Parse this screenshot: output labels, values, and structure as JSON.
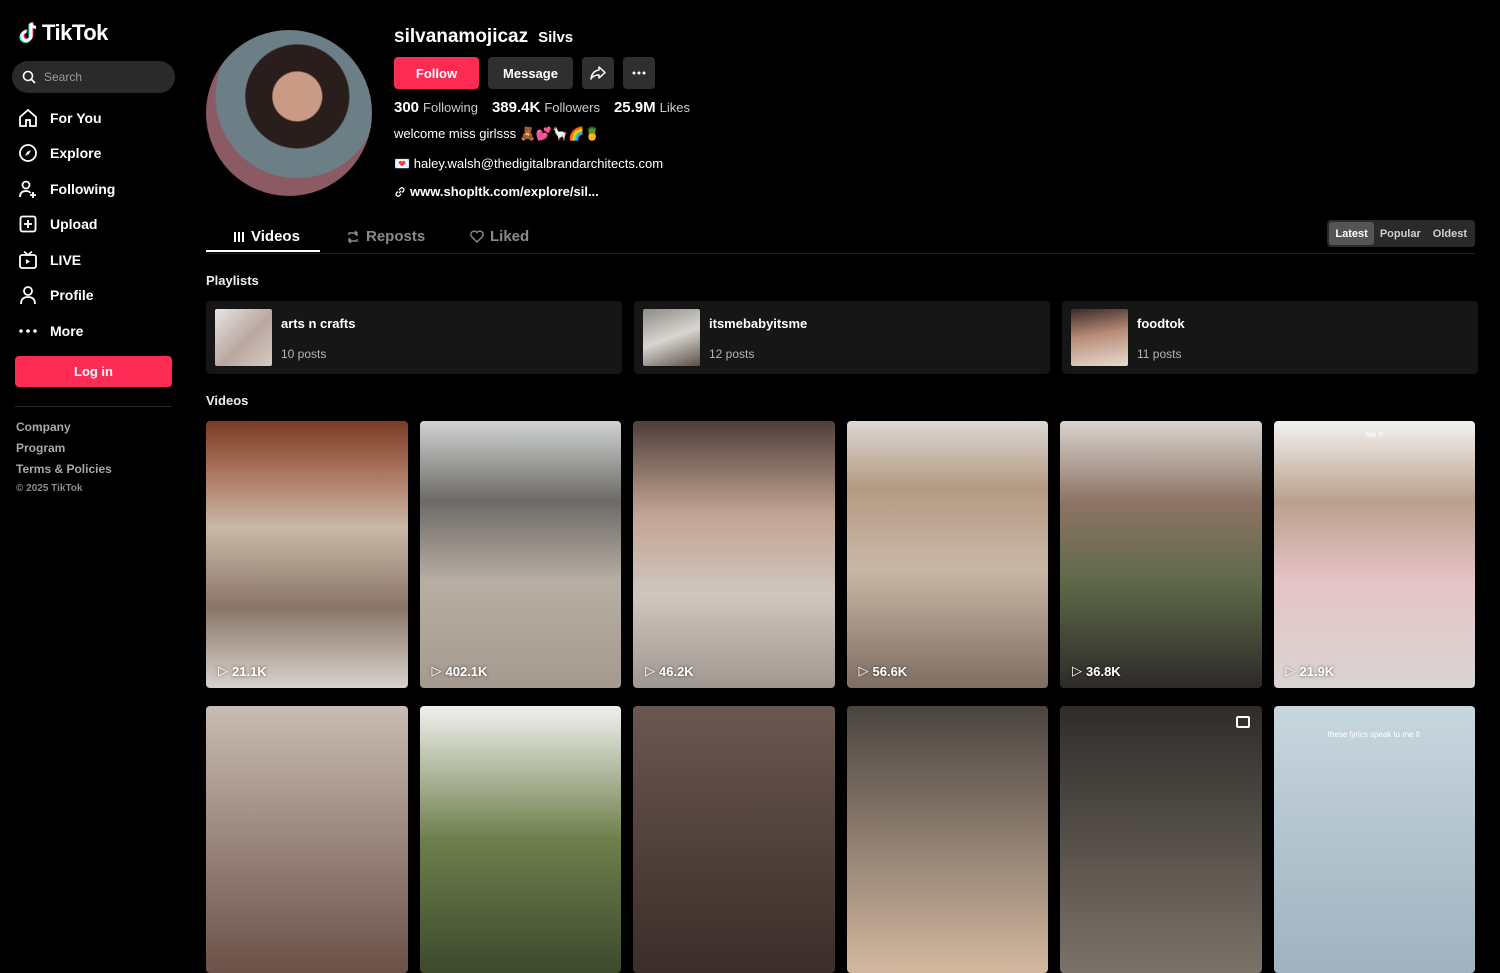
{
  "app": {
    "name": "TikTok"
  },
  "search": {
    "placeholder": "Search"
  },
  "sidebar": {
    "items": [
      {
        "label": "For You",
        "icon": "home-icon"
      },
      {
        "label": "Explore",
        "icon": "compass-icon"
      },
      {
        "label": "Following",
        "icon": "following-icon"
      },
      {
        "label": "Upload",
        "icon": "upload-icon"
      },
      {
        "label": "LIVE",
        "icon": "live-icon"
      },
      {
        "label": "Profile",
        "icon": "profile-icon"
      },
      {
        "label": "More",
        "icon": "more-icon"
      }
    ],
    "login_label": "Log in",
    "footer_links": [
      "Company",
      "Program",
      "Terms & Policies"
    ],
    "copyright": "© 2025 TikTok"
  },
  "profile": {
    "username": "silvanamojicaz",
    "nickname": "Silvs",
    "follow_label": "Follow",
    "message_label": "Message",
    "stats": [
      {
        "value": "300",
        "label": "Following"
      },
      {
        "value": "389.4K",
        "label": "Followers"
      },
      {
        "value": "25.9M",
        "label": "Likes"
      }
    ],
    "bio": "welcome miss girlsss 🧸💕🦙🌈🍍",
    "email": "💌 haley.walsh@thedigitalbrandarchitects.com",
    "link": "www.shopltk.com/explore/sil..."
  },
  "tabs": [
    {
      "label": "Videos",
      "icon": "grid-icon"
    },
    {
      "label": "Reposts",
      "icon": "repost-icon"
    },
    {
      "label": "Liked",
      "icon": "heart-icon"
    }
  ],
  "sort": {
    "options": [
      "Latest",
      "Popular",
      "Oldest"
    ],
    "selected": "Latest"
  },
  "playlists_title": "Playlists",
  "playlists": [
    {
      "name": "arts n crafts",
      "count": "10 posts"
    },
    {
      "name": "itsmebabyitsme",
      "count": "12 posts"
    },
    {
      "name": "foodtok",
      "count": "11 posts"
    }
  ],
  "videos_title": "Videos",
  "videos": [
    {
      "views": "21.1K",
      "overlay": ""
    },
    {
      "views": "402.1K",
      "overlay": ""
    },
    {
      "views": "46.2K",
      "overlay": ""
    },
    {
      "views": "56.6K",
      "overlay": ""
    },
    {
      "views": "36.8K",
      "overlay": ""
    },
    {
      "views": "21.9K",
      "overlay": "Me fr"
    },
    {
      "views": "",
      "overlay": ""
    },
    {
      "views": "",
      "overlay": ""
    },
    {
      "views": "",
      "overlay": ""
    },
    {
      "views": "",
      "overlay": ""
    },
    {
      "views": "",
      "overlay": ""
    },
    {
      "views": "",
      "overlay": "these lyrics speak to me fr"
    }
  ],
  "colors": {
    "accent": "#fe2c55",
    "background": "#000000",
    "panel": "#161616"
  }
}
